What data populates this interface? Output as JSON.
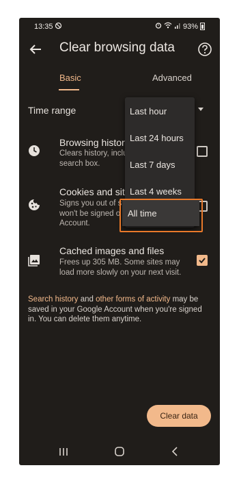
{
  "status_bar": {
    "time": "13:35",
    "battery": "93%"
  },
  "app_bar": {
    "title": "Clear browsing data"
  },
  "tabs": [
    {
      "label": "Basic",
      "selected": true
    },
    {
      "label": "Advanced",
      "selected": false
    }
  ],
  "time_range": {
    "label": "Time range",
    "options": [
      "Last hour",
      "Last 24 hours",
      "Last 7 days",
      "Last 4 weeks",
      "All time"
    ],
    "highlighted": "All time"
  },
  "items": [
    {
      "title": "Browsing history",
      "desc_line1": "Clears history, inclu",
      "desc_line2": "search box.",
      "desc_line3": "",
      "checked": false,
      "icon": "clock-icon"
    },
    {
      "title": "Cookies and site",
      "desc_line1": "Signs you out of s",
      "desc_line2": "won't be signed o",
      "desc_line3": "Account.",
      "checked": false,
      "icon": "cookie-icon"
    },
    {
      "title": "Cached images and files",
      "desc_line1": "Frees up 305 MB. Some sites may",
      "desc_line2": "load more slowly on your next visit.",
      "desc_line3": "",
      "checked": true,
      "icon": "image-icon"
    }
  ],
  "footnote": {
    "link1": "Search history",
    "text1": " and ",
    "link2": "other forms of activity",
    "text2": " may be saved in your Google Account when you're signed in. You can delete them anytime."
  },
  "clear_button": "Clear data",
  "colors": {
    "accent": "#f2b98b",
    "highlight_border": "#e9792a",
    "background": "#201d1a"
  }
}
